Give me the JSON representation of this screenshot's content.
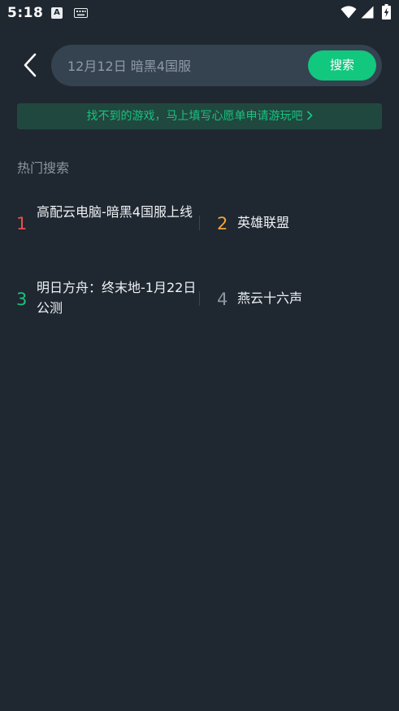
{
  "status_bar": {
    "time": "5:18",
    "notification_letter": "A",
    "icons": [
      "a-notification-icon",
      "keyboard-icon",
      "wifi-icon",
      "signal-icon",
      "battery-charging-icon"
    ]
  },
  "header": {
    "back_icon": "chevron-left-icon",
    "search_placeholder": "12月12日 暗黑4国服",
    "search_button_label": "搜索"
  },
  "banner": {
    "text": "找不到的游戏，马上填写心愿单申请游玩吧",
    "chevron_icon": "chevron-right-icon"
  },
  "hot_search": {
    "title": "热门搜索",
    "items": [
      {
        "rank": "1",
        "label": "高配云电脑-暗黑4国服上线",
        "rank_color": "#e5504f"
      },
      {
        "rank": "2",
        "label": "英雄联盟",
        "rank_color": "#f2a43a"
      },
      {
        "rank": "3",
        "label": "明日方舟：终末地-1月22日公测",
        "rank_color": "#19c17f"
      },
      {
        "rank": "4",
        "label": "燕云十六声",
        "rank_color": "#8b96a2"
      }
    ]
  },
  "colors": {
    "background": "#1f2730",
    "accent": "#12c77e",
    "search_box": "#354250",
    "banner_bg": "#20483f"
  }
}
